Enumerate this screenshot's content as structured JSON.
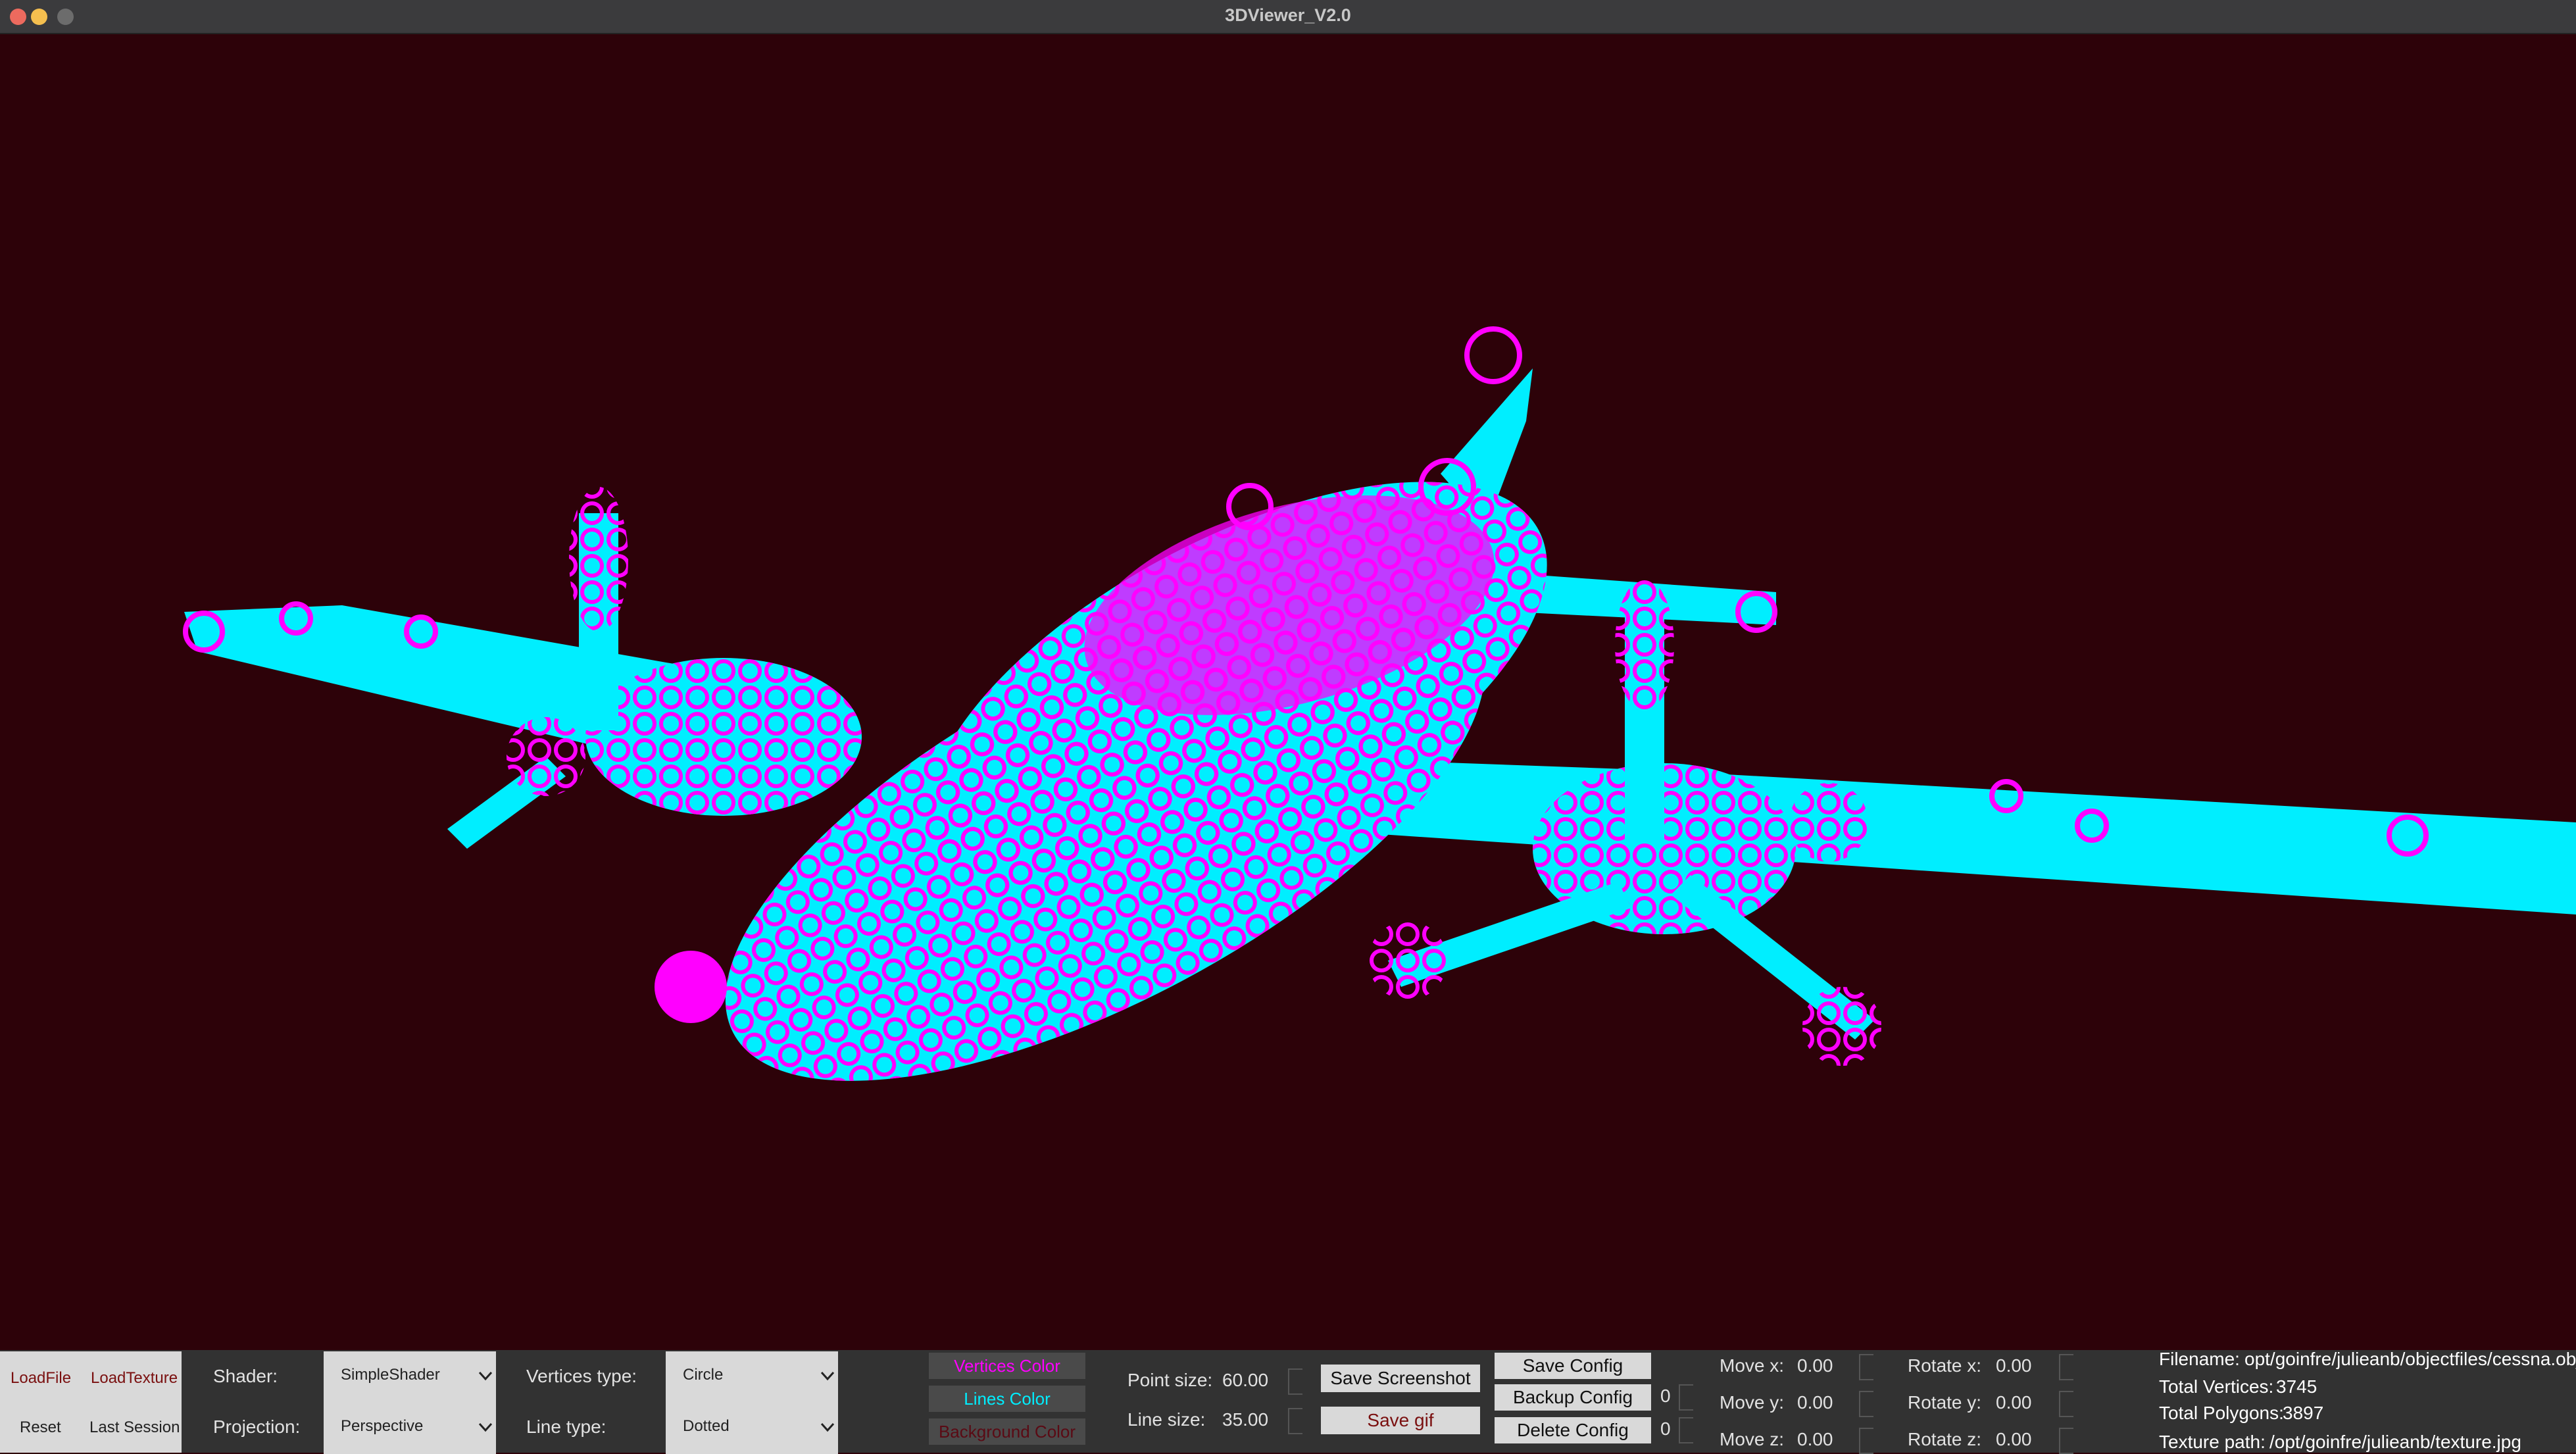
{
  "window": {
    "title": "3DViewer_V2.0"
  },
  "toolbar": {
    "load_file": "LoadFile",
    "load_texture": "LoadTexture",
    "reset": "Reset",
    "last_session": "Last Session",
    "shader_label": "Shader:",
    "shader_value": "SimpleShader",
    "projection_label": "Projection:",
    "projection_value": "Perspective",
    "vertices_type_label": "Vertices type:",
    "vertices_type_value": "Circle",
    "line_type_label": "Line type:",
    "line_type_value": "Dotted",
    "vertices_color": "Vertices Color",
    "lines_color": "Lines Color",
    "background_color": "Background Color",
    "point_size_label": "Point size:",
    "point_size_value": "60.00",
    "line_size_label": "Line size:",
    "line_size_value": "35.00",
    "save_screenshot": "Save Screenshot",
    "save_gif": "Save gif",
    "save_config": "Save Config",
    "backup_config": "Backup Config",
    "delete_config": "Delete Config",
    "backup_index": "0",
    "delete_index": "0",
    "move_x_label": "Move x:",
    "move_x_value": "0.00",
    "move_y_label": "Move y:",
    "move_y_value": "0.00",
    "move_z_label": "Move z:",
    "move_z_value": "0.00",
    "rotate_x_label": "Rotate x:",
    "rotate_x_value": "0.00",
    "rotate_y_label": "Rotate y:",
    "rotate_y_value": "0.00",
    "rotate_z_label": "Rotate z:",
    "rotate_z_value": "0.00"
  },
  "info": {
    "filename_label": "Filename:",
    "filename_value": "opt/goinfre/julieanb/objectfiles/cessna.obj",
    "vertices_label": "Total Vertices:",
    "vertices_value": "3745",
    "polygons_label": "Total Polygons:",
    "polygons_value": "3897",
    "texture_label": "Texture path:",
    "texture_value": "/opt/goinfre/julieanb/texture.jpg"
  },
  "colors": {
    "vertices": "#ff00ff",
    "lines": "#00eeff",
    "background": "#2d0209",
    "close": "#ed6a5e",
    "minimize": "#f5bf4f",
    "maximize": "#6c6c6c"
  }
}
